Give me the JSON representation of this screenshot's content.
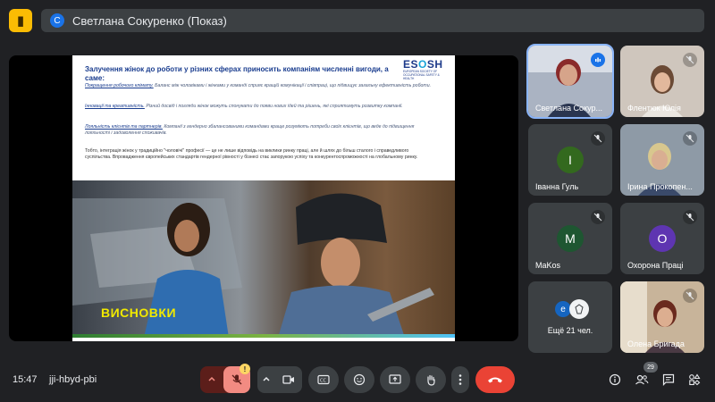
{
  "presenter_banner": {
    "avatar_letter": "С",
    "text": "Светлана Сокуренко (Показ)"
  },
  "slide": {
    "title": "Залучення жінок до роботи у різних сферах приносить компаніям численні вигоди, а саме:",
    "logo_word_left": "ES",
    "logo_word_accent": "O",
    "logo_word_right": "SH",
    "logo_sub": "EUROPEAN SOCIETY OF OCCUPATIONAL SAFETY & HEALTH",
    "paragraphs": [
      {
        "lead": "Покращення робочого клімату.",
        "text": " Баланс між чоловіками і жінками у команді сприяє кращій комунікації і співпраці, що підвищує загальну ефективність роботи."
      },
      {
        "lead": "Інновації та креативність.",
        "text": " Різний досвід і погляди жінок можуть спонукати до появи нових ідей та рішень, які сприятимуть розвитку компанії."
      },
      {
        "lead": "Лояльність клієнтів та партнерів.",
        "text": " Компанії з гендерно збалансованими командами краще розуміють потреби своїх клієнтів, що веде до підвищення лояльності і задоволення споживачів."
      }
    ],
    "summary": "Тобто, інтеграція жінок у традиційно \"чоловічі\" професії — це не лише відповідь на виклики ринку праці, але й шлях до більш сталого і справедливого суспільства. Впровадження європейських стандартів гендерної рівності у бізнесі стає запорукою успіху та конкурентоспроможності на глобальному ринку.",
    "conclusion": "ВИСНОВКИ"
  },
  "participants": [
    {
      "name": "Светлана Сокур...",
      "type": "video",
      "speaking": true
    },
    {
      "name": "Флентюк Юлія",
      "type": "video",
      "muted": true
    },
    {
      "name": "Іванна Гуль",
      "type": "avatar",
      "letter": "І",
      "color": "#33691e",
      "muted": true
    },
    {
      "name": "Ірина Прокопен...",
      "type": "video",
      "muted": true
    },
    {
      "name": "MaKos",
      "type": "avatar",
      "letter": "M",
      "color": "#1e5631",
      "muted": true
    },
    {
      "name": "Охорона Праці",
      "type": "avatar",
      "letter": "О",
      "color": "#5e35b1",
      "muted": true
    },
    {
      "name": "Ещё 21 чел.",
      "type": "more",
      "letter": "e",
      "color": "#1565c0"
    },
    {
      "name": "Олена Бригада",
      "type": "video",
      "muted": true
    }
  ],
  "bottom": {
    "time": "15:47",
    "meeting_code": "jji-hbyd-pbi",
    "people_count": "29",
    "mic_warning": "!"
  },
  "colors": {
    "background": "#202124",
    "tile": "#3c4043",
    "hangup": "#ea4335",
    "mic_off": "#f28b82",
    "accent": "#8ab4f8"
  }
}
